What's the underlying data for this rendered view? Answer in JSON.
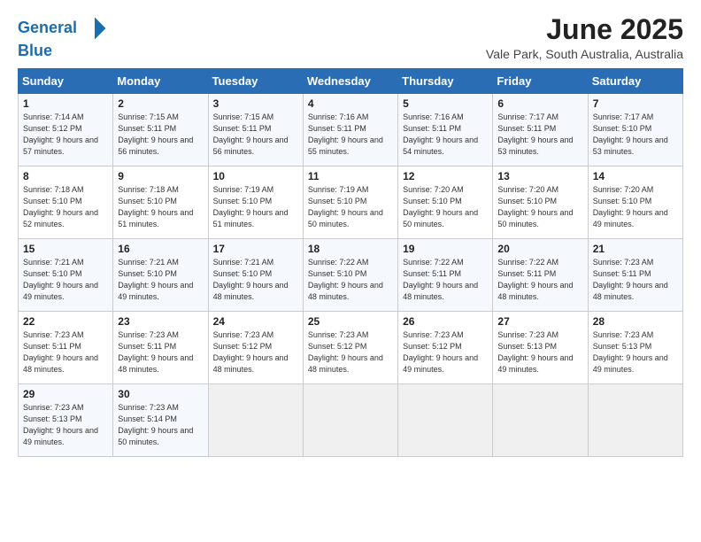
{
  "header": {
    "logo_line1": "General",
    "logo_line2": "Blue",
    "month": "June 2025",
    "location": "Vale Park, South Australia, Australia"
  },
  "weekdays": [
    "Sunday",
    "Monday",
    "Tuesday",
    "Wednesday",
    "Thursday",
    "Friday",
    "Saturday"
  ],
  "weeks": [
    [
      {
        "day": "1",
        "sunrise": "7:14 AM",
        "sunset": "5:12 PM",
        "daylight": "9 hours and 57 minutes."
      },
      {
        "day": "2",
        "sunrise": "7:15 AM",
        "sunset": "5:11 PM",
        "daylight": "9 hours and 56 minutes."
      },
      {
        "day": "3",
        "sunrise": "7:15 AM",
        "sunset": "5:11 PM",
        "daylight": "9 hours and 56 minutes."
      },
      {
        "day": "4",
        "sunrise": "7:16 AM",
        "sunset": "5:11 PM",
        "daylight": "9 hours and 55 minutes."
      },
      {
        "day": "5",
        "sunrise": "7:16 AM",
        "sunset": "5:11 PM",
        "daylight": "9 hours and 54 minutes."
      },
      {
        "day": "6",
        "sunrise": "7:17 AM",
        "sunset": "5:11 PM",
        "daylight": "9 hours and 53 minutes."
      },
      {
        "day": "7",
        "sunrise": "7:17 AM",
        "sunset": "5:10 PM",
        "daylight": "9 hours and 53 minutes."
      }
    ],
    [
      {
        "day": "8",
        "sunrise": "7:18 AM",
        "sunset": "5:10 PM",
        "daylight": "9 hours and 52 minutes."
      },
      {
        "day": "9",
        "sunrise": "7:18 AM",
        "sunset": "5:10 PM",
        "daylight": "9 hours and 51 minutes."
      },
      {
        "day": "10",
        "sunrise": "7:19 AM",
        "sunset": "5:10 PM",
        "daylight": "9 hours and 51 minutes."
      },
      {
        "day": "11",
        "sunrise": "7:19 AM",
        "sunset": "5:10 PM",
        "daylight": "9 hours and 50 minutes."
      },
      {
        "day": "12",
        "sunrise": "7:20 AM",
        "sunset": "5:10 PM",
        "daylight": "9 hours and 50 minutes."
      },
      {
        "day": "13",
        "sunrise": "7:20 AM",
        "sunset": "5:10 PM",
        "daylight": "9 hours and 50 minutes."
      },
      {
        "day": "14",
        "sunrise": "7:20 AM",
        "sunset": "5:10 PM",
        "daylight": "9 hours and 49 minutes."
      }
    ],
    [
      {
        "day": "15",
        "sunrise": "7:21 AM",
        "sunset": "5:10 PM",
        "daylight": "9 hours and 49 minutes."
      },
      {
        "day": "16",
        "sunrise": "7:21 AM",
        "sunset": "5:10 PM",
        "daylight": "9 hours and 49 minutes."
      },
      {
        "day": "17",
        "sunrise": "7:21 AM",
        "sunset": "5:10 PM",
        "daylight": "9 hours and 48 minutes."
      },
      {
        "day": "18",
        "sunrise": "7:22 AM",
        "sunset": "5:10 PM",
        "daylight": "9 hours and 48 minutes."
      },
      {
        "day": "19",
        "sunrise": "7:22 AM",
        "sunset": "5:11 PM",
        "daylight": "9 hours and 48 minutes."
      },
      {
        "day": "20",
        "sunrise": "7:22 AM",
        "sunset": "5:11 PM",
        "daylight": "9 hours and 48 minutes."
      },
      {
        "day": "21",
        "sunrise": "7:23 AM",
        "sunset": "5:11 PM",
        "daylight": "9 hours and 48 minutes."
      }
    ],
    [
      {
        "day": "22",
        "sunrise": "7:23 AM",
        "sunset": "5:11 PM",
        "daylight": "9 hours and 48 minutes."
      },
      {
        "day": "23",
        "sunrise": "7:23 AM",
        "sunset": "5:11 PM",
        "daylight": "9 hours and 48 minutes."
      },
      {
        "day": "24",
        "sunrise": "7:23 AM",
        "sunset": "5:12 PM",
        "daylight": "9 hours and 48 minutes."
      },
      {
        "day": "25",
        "sunrise": "7:23 AM",
        "sunset": "5:12 PM",
        "daylight": "9 hours and 48 minutes."
      },
      {
        "day": "26",
        "sunrise": "7:23 AM",
        "sunset": "5:12 PM",
        "daylight": "9 hours and 49 minutes."
      },
      {
        "day": "27",
        "sunrise": "7:23 AM",
        "sunset": "5:13 PM",
        "daylight": "9 hours and 49 minutes."
      },
      {
        "day": "28",
        "sunrise": "7:23 AM",
        "sunset": "5:13 PM",
        "daylight": "9 hours and 49 minutes."
      }
    ],
    [
      {
        "day": "29",
        "sunrise": "7:23 AM",
        "sunset": "5:13 PM",
        "daylight": "9 hours and 49 minutes."
      },
      {
        "day": "30",
        "sunrise": "7:23 AM",
        "sunset": "5:14 PM",
        "daylight": "9 hours and 50 minutes."
      },
      null,
      null,
      null,
      null,
      null
    ]
  ]
}
